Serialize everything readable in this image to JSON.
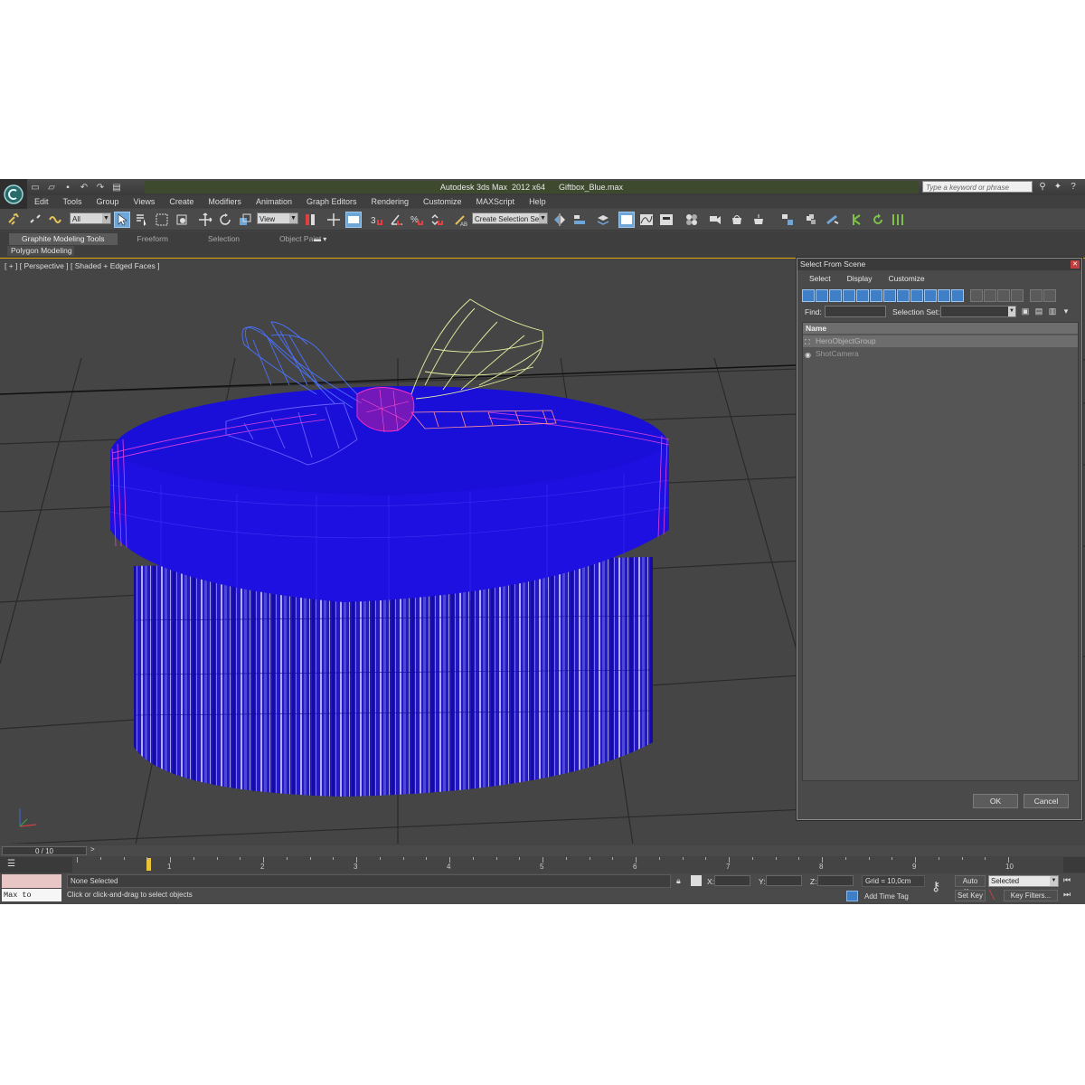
{
  "titlebar": {
    "app_title": "Autodesk 3ds Max  2012 x64",
    "file_name": "Giftbox_Blue.max",
    "search_placeholder": "Type a keyword or phrase"
  },
  "menu": [
    "Edit",
    "Tools",
    "Group",
    "Views",
    "Create",
    "Modifiers",
    "Animation",
    "Graph Editors",
    "Rendering",
    "Customize",
    "MAXScript",
    "Help"
  ],
  "toolbar": {
    "selection_filter": "All",
    "ref_coord": "View",
    "named_selection": "Create Selection Se"
  },
  "ribbon": {
    "tabs": [
      "Graphite Modeling Tools",
      "Freeform",
      "Selection",
      "Object Paint"
    ],
    "sub_panel": "Polygon Modeling"
  },
  "viewport": {
    "label": "[ + ] [ Perspective ] [ Shaded + Edged Faces ]"
  },
  "dialog": {
    "title": "Select From Scene",
    "menu": [
      "Select",
      "Display",
      "Customize"
    ],
    "find_label": "Find:",
    "selection_set_label": "Selection Set:",
    "column_name": "Name",
    "items": [
      "HeroObjectGroup",
      "ShotCamera"
    ],
    "ok": "OK",
    "cancel": "Cancel"
  },
  "timeline": {
    "frame_display": "0 / 10",
    "ticks": [
      "1",
      "2",
      "3",
      "4",
      "5",
      "6",
      "7",
      "8",
      "9",
      "10"
    ]
  },
  "status": {
    "maxscript_text": "Max to Physc.",
    "selection_status": "None Selected",
    "prompt": "Click or click-and-drag to select objects",
    "x_label": "X:",
    "y_label": "Y:",
    "z_label": "Z:",
    "grid": "Grid = 10,0cm",
    "add_time_tag": "Add Time Tag",
    "auto_key": "Auto Key",
    "set_key": "Set Key",
    "key_mode": "Selected",
    "key_filters": "Key Filters..."
  },
  "colors": {
    "box_blue": "#1a0fd8",
    "lid_blue": "#1d10e0",
    "ribbon_pink": "#e040e0",
    "bow_blue": "#3050e0",
    "bow_yellow": "#e8f0a0",
    "selection_blue": "#6fa6d8",
    "viewport_border": "#d9a400"
  }
}
